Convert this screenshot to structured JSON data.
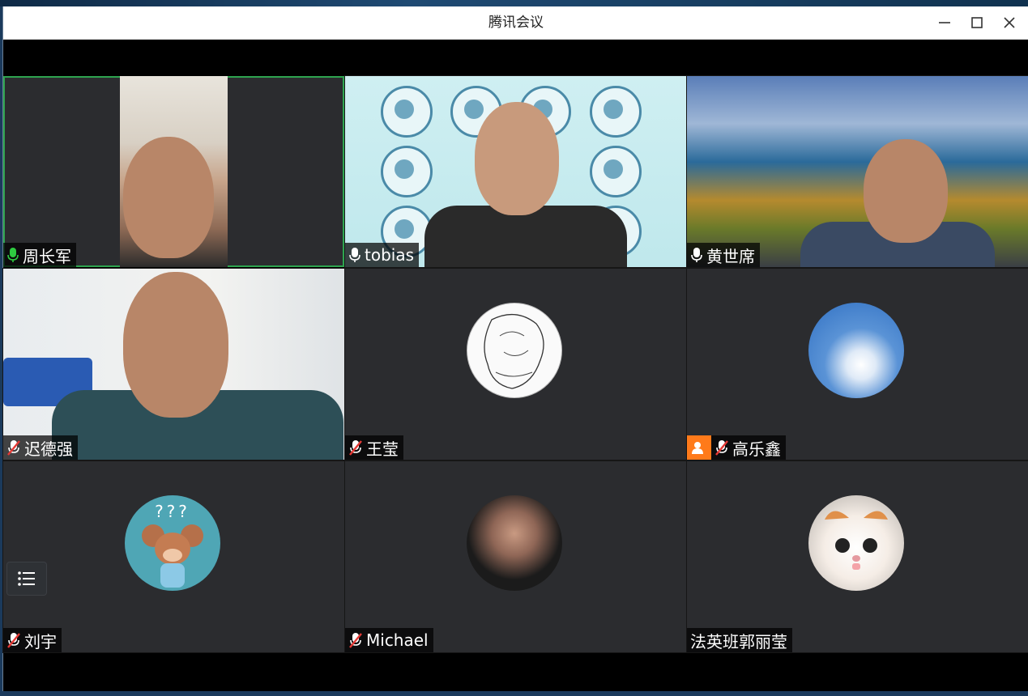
{
  "window": {
    "title": "腾讯会议",
    "controls": [
      "minimize-icon",
      "maximize-icon",
      "close-icon"
    ]
  },
  "participants": [
    {
      "name": "周长军",
      "mic": "on",
      "video": "on",
      "active_speaker": true
    },
    {
      "name": "tobias",
      "mic": "on",
      "video": "on"
    },
    {
      "name": "黄世席",
      "mic": "on",
      "video": "on"
    },
    {
      "name": "迟德强",
      "mic": "muted",
      "video": "on"
    },
    {
      "name": "王莹",
      "mic": "muted",
      "video": "off",
      "avatar": "sketch-avatar"
    },
    {
      "name": "高乐鑫",
      "mic": "muted",
      "video": "off",
      "avatar": "sky-avatar",
      "badge": "person-icon"
    },
    {
      "name": "刘宇",
      "mic": "muted",
      "video": "off",
      "avatar": "jerry-mouse-avatar",
      "avatar_text": "???"
    },
    {
      "name": "Michael",
      "mic": "muted",
      "video": "off",
      "avatar": "man-portrait-avatar"
    },
    {
      "name": "法英班郭丽莹",
      "mic": "none",
      "video": "off",
      "avatar": "cat-avatar"
    }
  ],
  "colors": {
    "mic_on": "#2ecc40",
    "mic_muted": "#e53935",
    "active_border": "#2ea44f",
    "tile_bg": "#2b2c2f",
    "host_badge": "#ff7a1a"
  },
  "controls": {
    "list_button_icon": "list-icon"
  }
}
